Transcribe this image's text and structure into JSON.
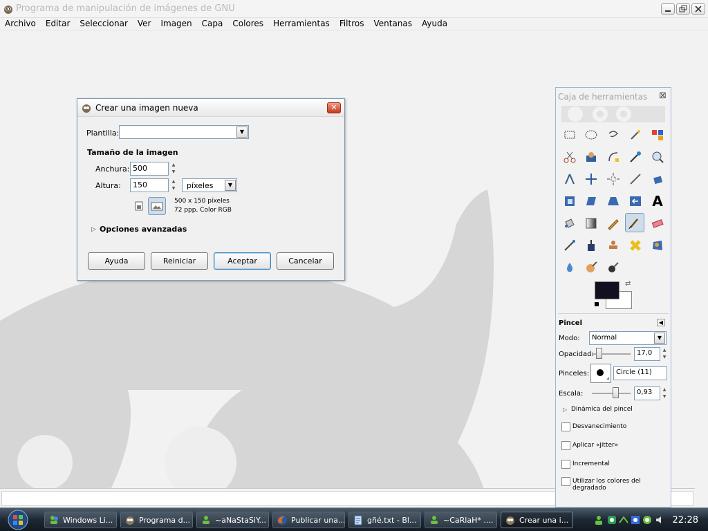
{
  "window": {
    "title": "Programa de manipulación de imágenes de GNU"
  },
  "menu": [
    "Archivo",
    "Editar",
    "Seleccionar",
    "Ver",
    "Imagen",
    "Capa",
    "Colores",
    "Herramientas",
    "Filtros",
    "Ventanas",
    "Ayuda"
  ],
  "dialog": {
    "title": "Crear una imagen nueva",
    "template_label": "Plantilla:",
    "template_value": "",
    "size_heading": "Tamaño de la imagen",
    "width_label": "Anchura:",
    "width_value": "500",
    "height_label": "Altura:",
    "height_value": "150",
    "unit": "píxeles",
    "info_line1": "500 x 150 píxeles",
    "info_line2": "72 ppp, Color RGB",
    "advanced": "Opciones avanzadas",
    "buttons": {
      "help": "Ayuda",
      "reset": "Reiniciar",
      "ok": "Aceptar",
      "cancel": "Cancelar"
    }
  },
  "toolbox": {
    "title": "Caja de herramientas",
    "fg_color": "#12101e",
    "bg_color": "#ffffff",
    "options": {
      "tool_name": "Pincel",
      "mode_label": "Modo:",
      "mode_value": "Normal",
      "opacity_label": "Opacidad:",
      "opacity_value": "17,0",
      "brush_label": "Pinceles:",
      "brush_value": "Circle (11)",
      "scale_label": "Escala:",
      "scale_value": "0,93",
      "dynamics": "Dinámica del pincel",
      "checks": [
        "Desvanecimiento",
        "Aplicar «jitter»",
        "Incremental",
        "Utilizar los colores del degradado"
      ]
    }
  },
  "taskbar": {
    "items": [
      "Windows Li...",
      "Programa d...",
      "~aNaStaSiY...",
      "Publicar una...",
      "gñé.txt - Bl...",
      "~CaRlaH* ....",
      "Crear una i..."
    ],
    "clock": "22:28"
  }
}
